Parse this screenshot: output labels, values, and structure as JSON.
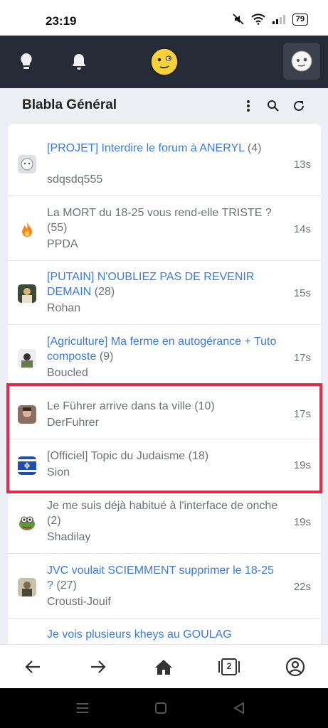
{
  "status_bar": {
    "time": "23:19",
    "battery": "79"
  },
  "header": {
    "title": "Blabla Général"
  },
  "topics": [
    {
      "title": "[PROJET] Interdire le forum à ANERYL",
      "count": "(4)",
      "author": "sdqsdq555",
      "time": "13s",
      "color": "blue",
      "avatar": "bot-face"
    },
    {
      "title": "La MORT du 18-25 vous rend-elle TRISTE ?",
      "count": "(55)",
      "author": "PPDA",
      "time": "14s",
      "color": "grey",
      "avatar": "flame"
    },
    {
      "title": "[PUTAIN] N'OUBLIEZ PAS DE REVENIR DEMAIN",
      "count": "(28)",
      "author": "Rohan",
      "time": "15s",
      "color": "blue",
      "avatar": "portrait"
    },
    {
      "title": "[Agriculture] Ma ferme en autogérance + Tuto composte",
      "count": "(9)",
      "author": "Boucled",
      "time": "17s",
      "color": "blue",
      "avatar": "portrait"
    },
    {
      "title": "Le Führer arrive dans ta ville",
      "count": "(10)",
      "author": "DerFuhrer",
      "time": "17s",
      "color": "grey",
      "avatar": "portrait"
    },
    {
      "title": "[Officiel] Topic du Judaisme",
      "count": "(18)",
      "author": "Sion",
      "time": "19s",
      "color": "grey",
      "avatar": "flag"
    },
    {
      "title": "Je me suis déjà habitué à l'interface de onche",
      "count": "(2)",
      "author": "Shadilay",
      "time": "19s",
      "color": "grey",
      "avatar": "frog"
    },
    {
      "title": "JVC voulait SCIEMMENT supprimer le 18-25 ?",
      "count": "(27)",
      "author": "Crousti-Jouif",
      "time": "22s",
      "color": "blue",
      "avatar": "portrait"
    },
    {
      "title": "Je vois plusieurs kheys au GOULAG",
      "count": "",
      "author": "",
      "time": "",
      "color": "blue",
      "avatar": ""
    }
  ],
  "bottom_nav": {
    "tabs_count": "2"
  },
  "icons": [
    "bulb-icon",
    "bell-icon",
    "smiley-logo",
    "profile-avatar",
    "more-vert-icon",
    "search-icon",
    "refresh-icon",
    "back-arrow-icon",
    "forward-arrow-icon",
    "home-icon",
    "tabs-icon",
    "account-icon"
  ]
}
